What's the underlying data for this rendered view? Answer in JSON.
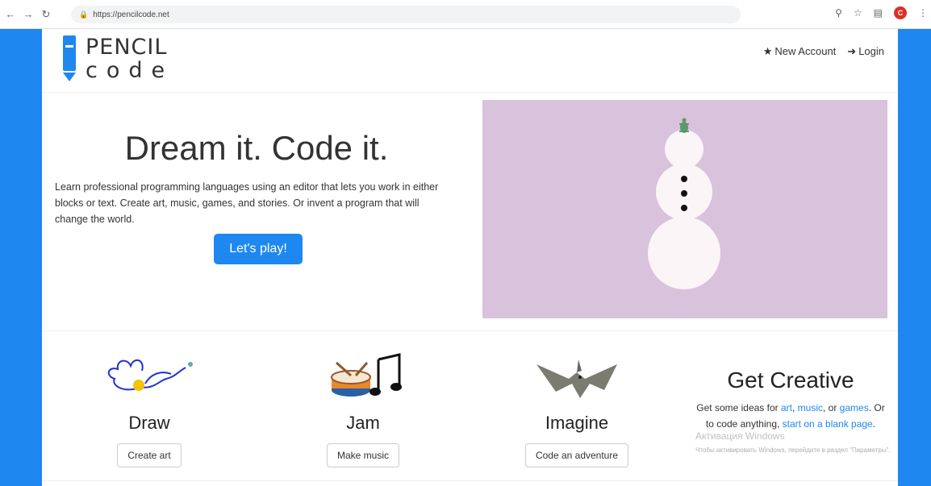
{
  "browser": {
    "url": "https://pencilcode.net"
  },
  "logo": {
    "line1": "PENCIL",
    "line2": "code"
  },
  "header": {
    "new_account": "New Account",
    "login": "Login"
  },
  "hero": {
    "title": "Dream it. Code it.",
    "description": "Learn professional programming languages using an editor that lets you work in either blocks or text. Create art, music, games, and stories. Or invent a program that will change the world.",
    "cta": "Let's play!"
  },
  "features": [
    {
      "title": "Draw",
      "button": "Create art"
    },
    {
      "title": "Jam",
      "button": "Make music"
    },
    {
      "title": "Imagine",
      "button": "Code an adventure"
    }
  ],
  "creative": {
    "title": "Get Creative",
    "text_1": "Get some ideas for ",
    "link_art": "art",
    "text_2": ", ",
    "link_music": "music",
    "text_3": ", or ",
    "link_games": "games",
    "text_4": ". Or to code anything, ",
    "link_blank": "start on a blank page",
    "text_5": "."
  },
  "os_watermark": {
    "title": "Активация Windows",
    "subtitle": "Чтобы активировать Windows, перейдите в раздел \"Параметры\"."
  },
  "colors": {
    "brand_blue": "#1e88f0",
    "canvas_bg": "#d9c2db"
  }
}
